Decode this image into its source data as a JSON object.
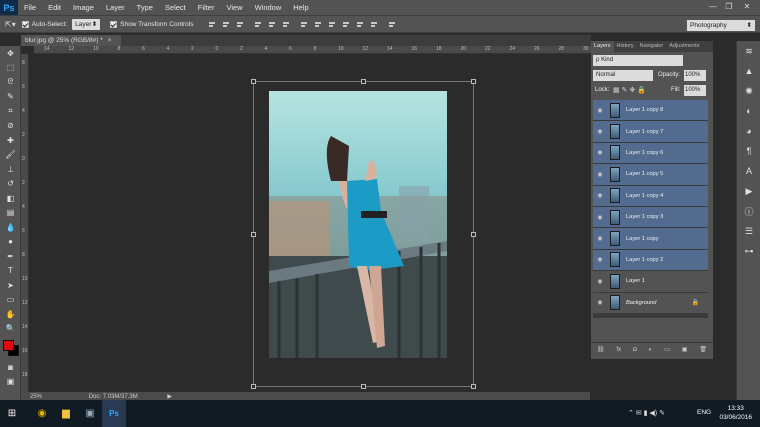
{
  "app": {
    "logo": "Ps"
  },
  "menubar": {
    "items": [
      "File",
      "Edit",
      "Image",
      "Layer",
      "Type",
      "Select",
      "Filter",
      "View",
      "Window",
      "Help"
    ]
  },
  "window_controls": {
    "minimize": "—",
    "restore": "❐",
    "close": "✕"
  },
  "options": {
    "auto_select_label": "Auto-Select:",
    "auto_select_value": "Layer",
    "transform_label": "Show Transform Controls"
  },
  "workspace": {
    "value": "Photography"
  },
  "document": {
    "tab_title": "blur.jpg @ 25% (RGB/8#) *",
    "tab_close": "×"
  },
  "ruler": {
    "h_ticks": [
      "14",
      "12",
      "10",
      "8",
      "6",
      "4",
      "2",
      "0",
      "2",
      "4",
      "6",
      "8",
      "10",
      "12",
      "14",
      "16",
      "18",
      "20",
      "22",
      "24",
      "26",
      "28",
      "30"
    ],
    "v_ticks": [
      "8",
      "6",
      "4",
      "2",
      "0",
      "2",
      "4",
      "6",
      "8",
      "10",
      "12",
      "14",
      "16",
      "18"
    ]
  },
  "status": {
    "zoom": "25%",
    "doc": "Doc: 7.03M/37.3M",
    "arrow": "▶"
  },
  "panels": {
    "tabs": [
      "Layers",
      "History",
      "Navigator",
      "Adjustments"
    ],
    "kind_label": "ρ Kind",
    "blend_mode": "Normal",
    "opacity_label": "Opacity:",
    "opacity_value": "100%",
    "lock_label": "Lock:",
    "fill_label": "Fill:",
    "fill_value": "100%"
  },
  "layers": [
    {
      "name": "Layer 1 copy 8"
    },
    {
      "name": "Layer 1 copy 7"
    },
    {
      "name": "Layer 1 copy 6"
    },
    {
      "name": "Layer 1 copy 5"
    },
    {
      "name": "Layer 1 copy 4"
    },
    {
      "name": "Layer 1 copy 3"
    },
    {
      "name": "Layer 1 copy"
    },
    {
      "name": "Layer 1 copy 2"
    },
    {
      "name": "Layer 1"
    },
    {
      "name": "Background"
    }
  ],
  "layer_footer": {
    "link": "⛓",
    "fx": "fx",
    "mask": "◘",
    "adjust": "◐",
    "group": "▭",
    "new": "▣",
    "delete": "🗑"
  },
  "colors": {
    "foreground": "#e3080f",
    "background": "#000000",
    "selected_layer": "#526b8f"
  },
  "taskbar": {
    "lang": "ENG",
    "time": "13:33",
    "date": "03/06/2016"
  }
}
